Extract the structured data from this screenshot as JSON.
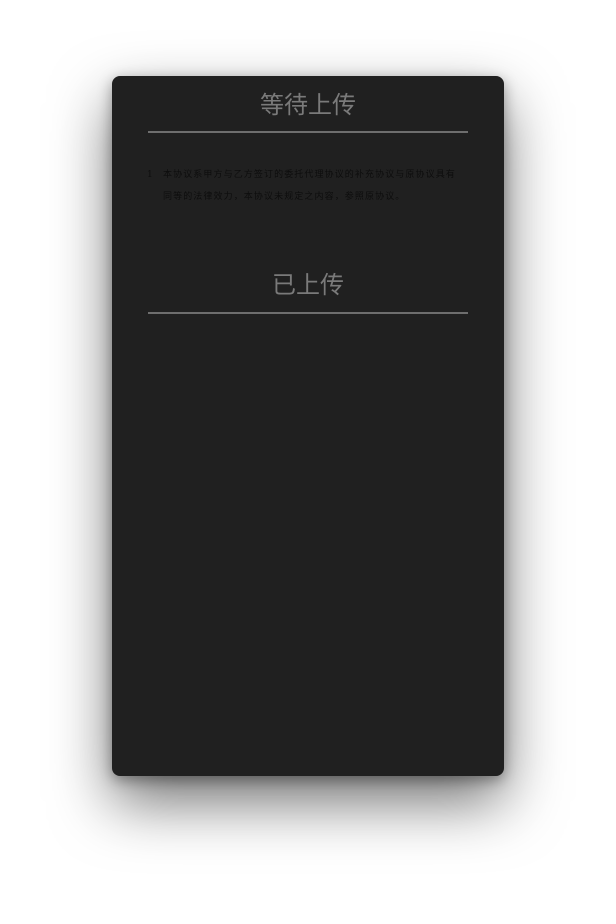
{
  "pending_section": {
    "title": "等待上传",
    "items": [
      {
        "number": "1",
        "text": "本协议系甲方与乙方签订的委托代理协议的补充协议与原协议具有同等的法律效力，本协议未规定之内容，参照原协议。"
      }
    ]
  },
  "uploaded_section": {
    "title": "已上传",
    "items": []
  }
}
